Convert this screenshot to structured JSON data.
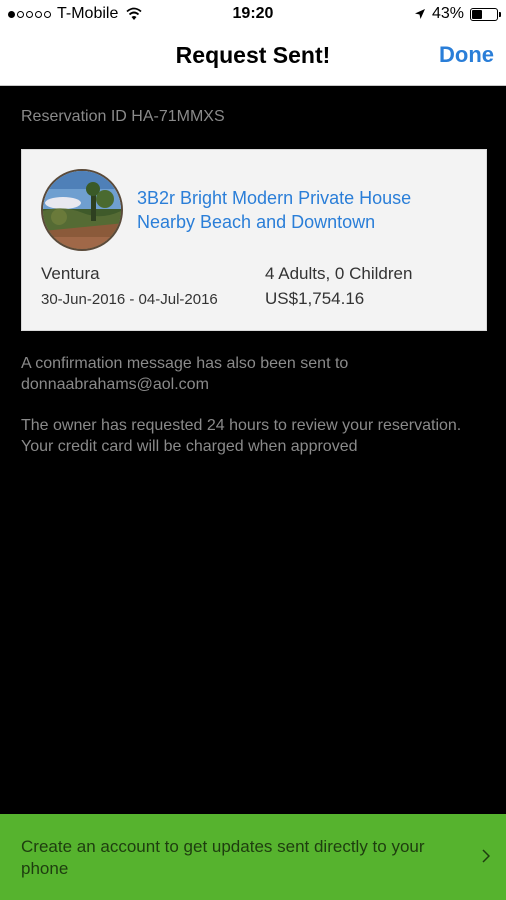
{
  "status_bar": {
    "carrier": "T-Mobile",
    "time": "19:20",
    "battery": "43%",
    "battery_level": 0.43
  },
  "nav": {
    "title": "Request Sent!",
    "done_label": "Done"
  },
  "reservation": {
    "id_text": "Reservation ID HA-71MMXS",
    "listing_title": "3B2r Bright Modern Private House Nearby Beach and Downtown",
    "location": "Ventura",
    "guests": "4 Adults, 0 Children",
    "dates": "30-Jun-2016 - 04-Jul-2016",
    "price": "US$1,754.16"
  },
  "messages": {
    "confirmation": "A confirmation message has also been sent to donnaabrahams@aol.com",
    "review": "The owner has requested 24 hours to review your reservation. Your credit card will be charged when approved"
  },
  "banner": {
    "text": "Create an account to get updates sent directly to your phone"
  },
  "colors": {
    "accent": "#2a7ed8",
    "banner": "#56b32e"
  }
}
